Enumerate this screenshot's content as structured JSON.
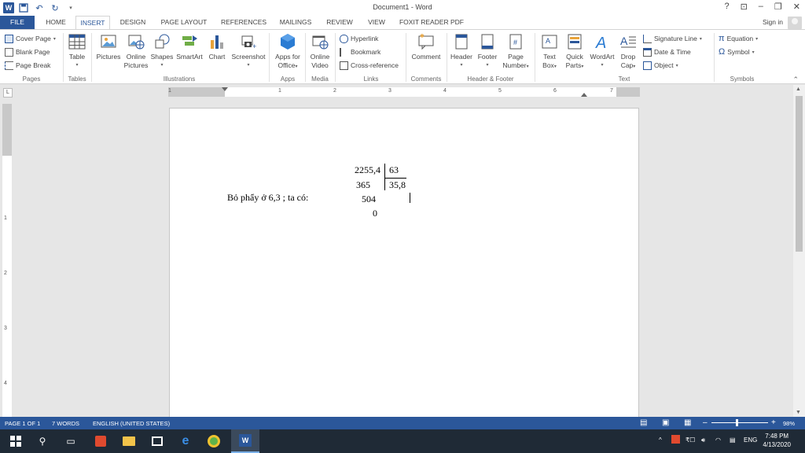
{
  "title_bar": {
    "title": "Document1 - Word",
    "help": "?",
    "ribbon_display": "⊡",
    "minimize": "–",
    "restore": "❐",
    "close": "✕"
  },
  "tabs": [
    "FILE",
    "HOME",
    "INSERT",
    "DESIGN",
    "PAGE LAYOUT",
    "REFERENCES",
    "MAILINGS",
    "REVIEW",
    "VIEW",
    "FOXIT READER PDF"
  ],
  "active_tab": "INSERT",
  "sign_in": "Sign in",
  "ribbon": {
    "pages": {
      "label": "Pages",
      "items": [
        "Cover Page",
        "Blank Page",
        "Page Break"
      ]
    },
    "tables": {
      "label": "Tables",
      "table": "Table"
    },
    "illustrations": {
      "label": "Illustrations",
      "pictures": "Pictures",
      "online_pictures_1": "Online",
      "online_pictures_2": "Pictures",
      "shapes": "Shapes",
      "smartart": "SmartArt",
      "chart": "Chart",
      "screenshot": "Screenshot"
    },
    "apps": {
      "label": "Apps",
      "apps_1": "Apps for",
      "apps_2": "Office"
    },
    "media": {
      "label": "Media",
      "video_1": "Online",
      "video_2": "Video"
    },
    "links": {
      "label": "Links",
      "items": [
        "Hyperlink",
        "Bookmark",
        "Cross-reference"
      ]
    },
    "comments": {
      "label": "Comments",
      "comment": "Comment"
    },
    "header_footer": {
      "label": "Header & Footer",
      "header": "Header",
      "footer": "Footer",
      "page_number_1": "Page",
      "page_number_2": "Number"
    },
    "text": {
      "label": "Text",
      "textbox_1": "Text",
      "textbox_2": "Box",
      "quickparts_1": "Quick",
      "quickparts_2": "Parts",
      "wordart": "WordArt",
      "dropcap_1": "Drop",
      "dropcap_2": "Cap",
      "signature": "Signature Line",
      "datetime": "Date & Time",
      "object": "Object"
    },
    "symbols": {
      "label": "Symbols",
      "equation": "Equation",
      "symbol": "Symbol"
    }
  },
  "ruler": {
    "numbers": [
      "1",
      "1",
      "2",
      "3",
      "4",
      "5",
      "6",
      "7"
    ],
    "vnumbers": [
      "1",
      "2",
      "3",
      "4"
    ]
  },
  "document": {
    "intro": "Bỏ phẩy ở 6,3 ; ta có:",
    "dividend": "2255,4",
    "divisor": "63",
    "step1": "365",
    "quotient": "35,8",
    "step2": "504",
    "remainder": "0"
  },
  "status": {
    "page": "PAGE 1 OF 1",
    "words": "7 WORDS",
    "language": "ENGLISH (UNITED STATES)",
    "zoom": "98%"
  },
  "taskbar": {
    "time": "7:48 PM",
    "date": "4/13/2020",
    "lang": "ENG"
  },
  "colors": {
    "word_blue": "#2b579a",
    "taskbar": "#1f2a36"
  }
}
